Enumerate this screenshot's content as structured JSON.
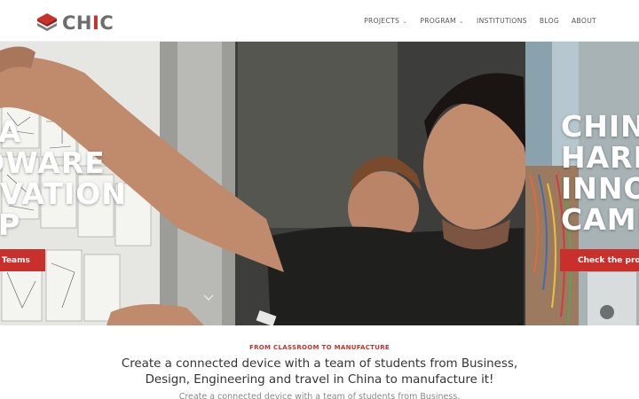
{
  "header": {
    "logo": {
      "text_gray_1": "C",
      "text_gray_2": "H",
      "text_red": "I",
      "text_gray_3": "C"
    },
    "nav": [
      {
        "label": "PROJECTS",
        "has_dropdown": true
      },
      {
        "label": "PROGRAM",
        "has_dropdown": true
      },
      {
        "label": "INSTITUTIONS",
        "has_dropdown": false
      },
      {
        "label": "BLOG",
        "has_dropdown": false
      },
      {
        "label": "ABOUT",
        "has_dropdown": false
      }
    ]
  },
  "hero": {
    "slide_left": {
      "lines": [
        "A",
        "DWARE",
        "OVATION",
        "P"
      ],
      "button_label": "Teams"
    },
    "slide_right": {
      "lines": [
        "CHIN",
        "HARD",
        "INNO",
        "CAMI"
      ],
      "button_label": "Check the pro"
    }
  },
  "intro": {
    "eyebrow": "FROM CLASSROOM TO MANUFACTURE",
    "headline_line1": "Create a connected device with a team of students from Business,",
    "headline_line2": "Design, Engineering and travel in China to manufacture it!",
    "subline": "Create a connected device with a team of students from Business,"
  },
  "colors": {
    "accent": "#c9302c",
    "logo_gray": "#6d6d6d",
    "nav_text": "#555555"
  },
  "icons": {
    "logo": "chic-cube-logo",
    "dropdown": "chevron-down-icon",
    "scroll": "chevron-down-icon"
  }
}
